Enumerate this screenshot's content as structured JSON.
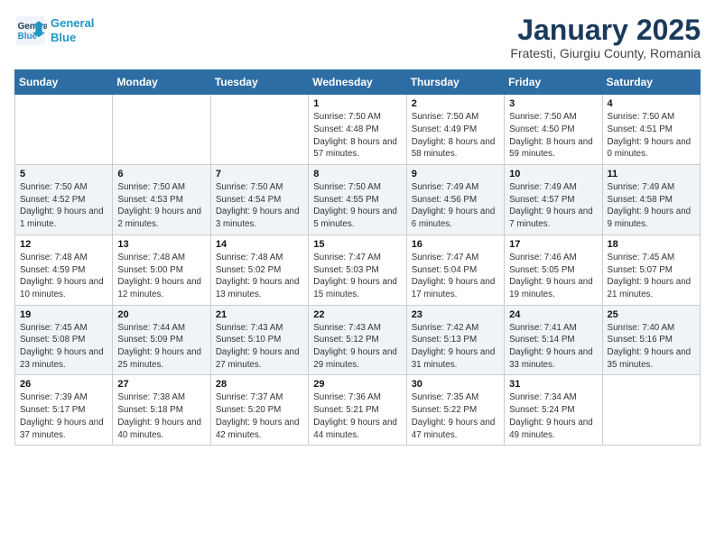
{
  "logo": {
    "line1": "General",
    "line2": "Blue"
  },
  "title": "January 2025",
  "subtitle": "Fratesti, Giurgiu County, Romania",
  "days_of_week": [
    "Sunday",
    "Monday",
    "Tuesday",
    "Wednesday",
    "Thursday",
    "Friday",
    "Saturday"
  ],
  "weeks": [
    [
      {
        "day": "",
        "info": ""
      },
      {
        "day": "",
        "info": ""
      },
      {
        "day": "",
        "info": ""
      },
      {
        "day": "1",
        "info": "Sunrise: 7:50 AM\nSunset: 4:48 PM\nDaylight: 8 hours and 57 minutes."
      },
      {
        "day": "2",
        "info": "Sunrise: 7:50 AM\nSunset: 4:49 PM\nDaylight: 8 hours and 58 minutes."
      },
      {
        "day": "3",
        "info": "Sunrise: 7:50 AM\nSunset: 4:50 PM\nDaylight: 8 hours and 59 minutes."
      },
      {
        "day": "4",
        "info": "Sunrise: 7:50 AM\nSunset: 4:51 PM\nDaylight: 9 hours and 0 minutes."
      }
    ],
    [
      {
        "day": "5",
        "info": "Sunrise: 7:50 AM\nSunset: 4:52 PM\nDaylight: 9 hours and 1 minute."
      },
      {
        "day": "6",
        "info": "Sunrise: 7:50 AM\nSunset: 4:53 PM\nDaylight: 9 hours and 2 minutes."
      },
      {
        "day": "7",
        "info": "Sunrise: 7:50 AM\nSunset: 4:54 PM\nDaylight: 9 hours and 3 minutes."
      },
      {
        "day": "8",
        "info": "Sunrise: 7:50 AM\nSunset: 4:55 PM\nDaylight: 9 hours and 5 minutes."
      },
      {
        "day": "9",
        "info": "Sunrise: 7:49 AM\nSunset: 4:56 PM\nDaylight: 9 hours and 6 minutes."
      },
      {
        "day": "10",
        "info": "Sunrise: 7:49 AM\nSunset: 4:57 PM\nDaylight: 9 hours and 7 minutes."
      },
      {
        "day": "11",
        "info": "Sunrise: 7:49 AM\nSunset: 4:58 PM\nDaylight: 9 hours and 9 minutes."
      }
    ],
    [
      {
        "day": "12",
        "info": "Sunrise: 7:48 AM\nSunset: 4:59 PM\nDaylight: 9 hours and 10 minutes."
      },
      {
        "day": "13",
        "info": "Sunrise: 7:48 AM\nSunset: 5:00 PM\nDaylight: 9 hours and 12 minutes."
      },
      {
        "day": "14",
        "info": "Sunrise: 7:48 AM\nSunset: 5:02 PM\nDaylight: 9 hours and 13 minutes."
      },
      {
        "day": "15",
        "info": "Sunrise: 7:47 AM\nSunset: 5:03 PM\nDaylight: 9 hours and 15 minutes."
      },
      {
        "day": "16",
        "info": "Sunrise: 7:47 AM\nSunset: 5:04 PM\nDaylight: 9 hours and 17 minutes."
      },
      {
        "day": "17",
        "info": "Sunrise: 7:46 AM\nSunset: 5:05 PM\nDaylight: 9 hours and 19 minutes."
      },
      {
        "day": "18",
        "info": "Sunrise: 7:45 AM\nSunset: 5:07 PM\nDaylight: 9 hours and 21 minutes."
      }
    ],
    [
      {
        "day": "19",
        "info": "Sunrise: 7:45 AM\nSunset: 5:08 PM\nDaylight: 9 hours and 23 minutes."
      },
      {
        "day": "20",
        "info": "Sunrise: 7:44 AM\nSunset: 5:09 PM\nDaylight: 9 hours and 25 minutes."
      },
      {
        "day": "21",
        "info": "Sunrise: 7:43 AM\nSunset: 5:10 PM\nDaylight: 9 hours and 27 minutes."
      },
      {
        "day": "22",
        "info": "Sunrise: 7:43 AM\nSunset: 5:12 PM\nDaylight: 9 hours and 29 minutes."
      },
      {
        "day": "23",
        "info": "Sunrise: 7:42 AM\nSunset: 5:13 PM\nDaylight: 9 hours and 31 minutes."
      },
      {
        "day": "24",
        "info": "Sunrise: 7:41 AM\nSunset: 5:14 PM\nDaylight: 9 hours and 33 minutes."
      },
      {
        "day": "25",
        "info": "Sunrise: 7:40 AM\nSunset: 5:16 PM\nDaylight: 9 hours and 35 minutes."
      }
    ],
    [
      {
        "day": "26",
        "info": "Sunrise: 7:39 AM\nSunset: 5:17 PM\nDaylight: 9 hours and 37 minutes."
      },
      {
        "day": "27",
        "info": "Sunrise: 7:38 AM\nSunset: 5:18 PM\nDaylight: 9 hours and 40 minutes."
      },
      {
        "day": "28",
        "info": "Sunrise: 7:37 AM\nSunset: 5:20 PM\nDaylight: 9 hours and 42 minutes."
      },
      {
        "day": "29",
        "info": "Sunrise: 7:36 AM\nSunset: 5:21 PM\nDaylight: 9 hours and 44 minutes."
      },
      {
        "day": "30",
        "info": "Sunrise: 7:35 AM\nSunset: 5:22 PM\nDaylight: 9 hours and 47 minutes."
      },
      {
        "day": "31",
        "info": "Sunrise: 7:34 AM\nSunset: 5:24 PM\nDaylight: 9 hours and 49 minutes."
      },
      {
        "day": "",
        "info": ""
      }
    ]
  ]
}
